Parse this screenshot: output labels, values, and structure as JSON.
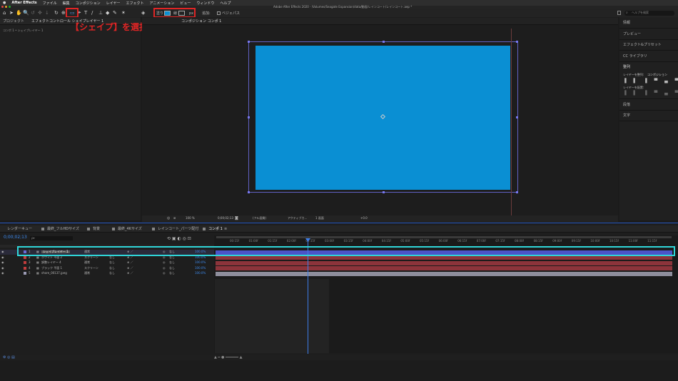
{
  "menubar": {
    "items": [
      "After Effects",
      "ファイル",
      "編集",
      "コンポジション",
      "レイヤー",
      "エフェクト",
      "アニメーション",
      "ビュー",
      "ウィンドウ",
      "ヘルプ"
    ]
  },
  "window": {
    "title": "Adobe After Effects 2020 - /Volumes/Seagate Expansion/data/動画/レインコート/レインコート.aep *"
  },
  "toolbar": {
    "fill_label": "塗り",
    "stroke_label": "線",
    "stroke_width": "px",
    "add_label": "追加:",
    "bezier_label": "ベジェパス",
    "search_placeholder": "ヘルプを検索"
  },
  "annotation": {
    "text": "【シェイプ】を選択して、背景の色を全面にします"
  },
  "project_panel": {
    "tabs": [
      "プロジェクト",
      "エフェクトコントロール シェイプレイヤー 1"
    ],
    "breadcrumb": "コンポ 1 • シェイプレイヤー 1"
  },
  "comp_panel": {
    "tab": "コンポジション コンポ 1",
    "zoom": "100 %",
    "timecode": "0;00;02;13",
    "quality": "(フル画質)",
    "camera": "アクティブカ...",
    "views": "1 画面",
    "offset": "+0.0",
    "shape_color": "#0a8fd3"
  },
  "right_panel": {
    "items": [
      "情報",
      "プレビュー",
      "エフェクト&プリセット",
      "CC ライブラリ",
      "整列",
      "段落",
      "文字"
    ],
    "align_to_label": "レイヤーを整列:",
    "align_to_value": "コンポジション",
    "distribute_label": "レイヤーを配置:"
  },
  "timeline": {
    "tabs": [
      "レンダーキュー",
      "最終_フルHDサイズ",
      "背景",
      "最終_4Kサイズ",
      "レインコート_パーツ配付",
      "コンポ 1"
    ],
    "timecode": "0;00;02;13",
    "search_placeholder": "ρ▾",
    "ruler": [
      "00:15f",
      "01:00f",
      "01:15f",
      "02:00f",
      "02:15f",
      "03:00f",
      "03:15f",
      "04:00f",
      "04:15f",
      "05:00f",
      "05:15f",
      "06:00f",
      "06:15f",
      "07:00f",
      "07:15f",
      "08:00f",
      "08:15f",
      "09:00f",
      "09:15f",
      "10:00f",
      "10:15f",
      "11:00f",
      "11:15f"
    ],
    "layers": [
      {
        "num": "1",
        "name": "シェイプレイヤー 1",
        "mode": "通常",
        "trkmat": "",
        "parent": "なし",
        "stretch": "100.0%",
        "color": "#4b54c8",
        "label_color": "#6a6ad8"
      },
      {
        "num": "2",
        "name": "ホワイト 平面 2",
        "mode": "スクリーン",
        "trkmat": "なし",
        "parent": "なし",
        "stretch": "100.0%",
        "color": "#8c343b",
        "label_color": "#c23c3c"
      },
      {
        "num": "3",
        "name": "調整レイヤー 4",
        "mode": "通常",
        "trkmat": "なし",
        "parent": "なし",
        "stretch": "100.0%",
        "color": "#8c343b",
        "label_color": "#c23c3c"
      },
      {
        "num": "4",
        "name": "ブラック 平面 1",
        "mode": "スクリーン",
        "trkmat": "なし",
        "parent": "なし",
        "stretch": "100.0%",
        "color": "#8c343b",
        "label_color": "#c23c3c"
      },
      {
        "num": "5",
        "name": "shore_00137.jpeg",
        "mode": "通常",
        "trkmat": "なし",
        "parent": "なし",
        "stretch": "100.0%",
        "color": "#8e8e9c",
        "label_color": "#9b9bb4"
      }
    ]
  }
}
